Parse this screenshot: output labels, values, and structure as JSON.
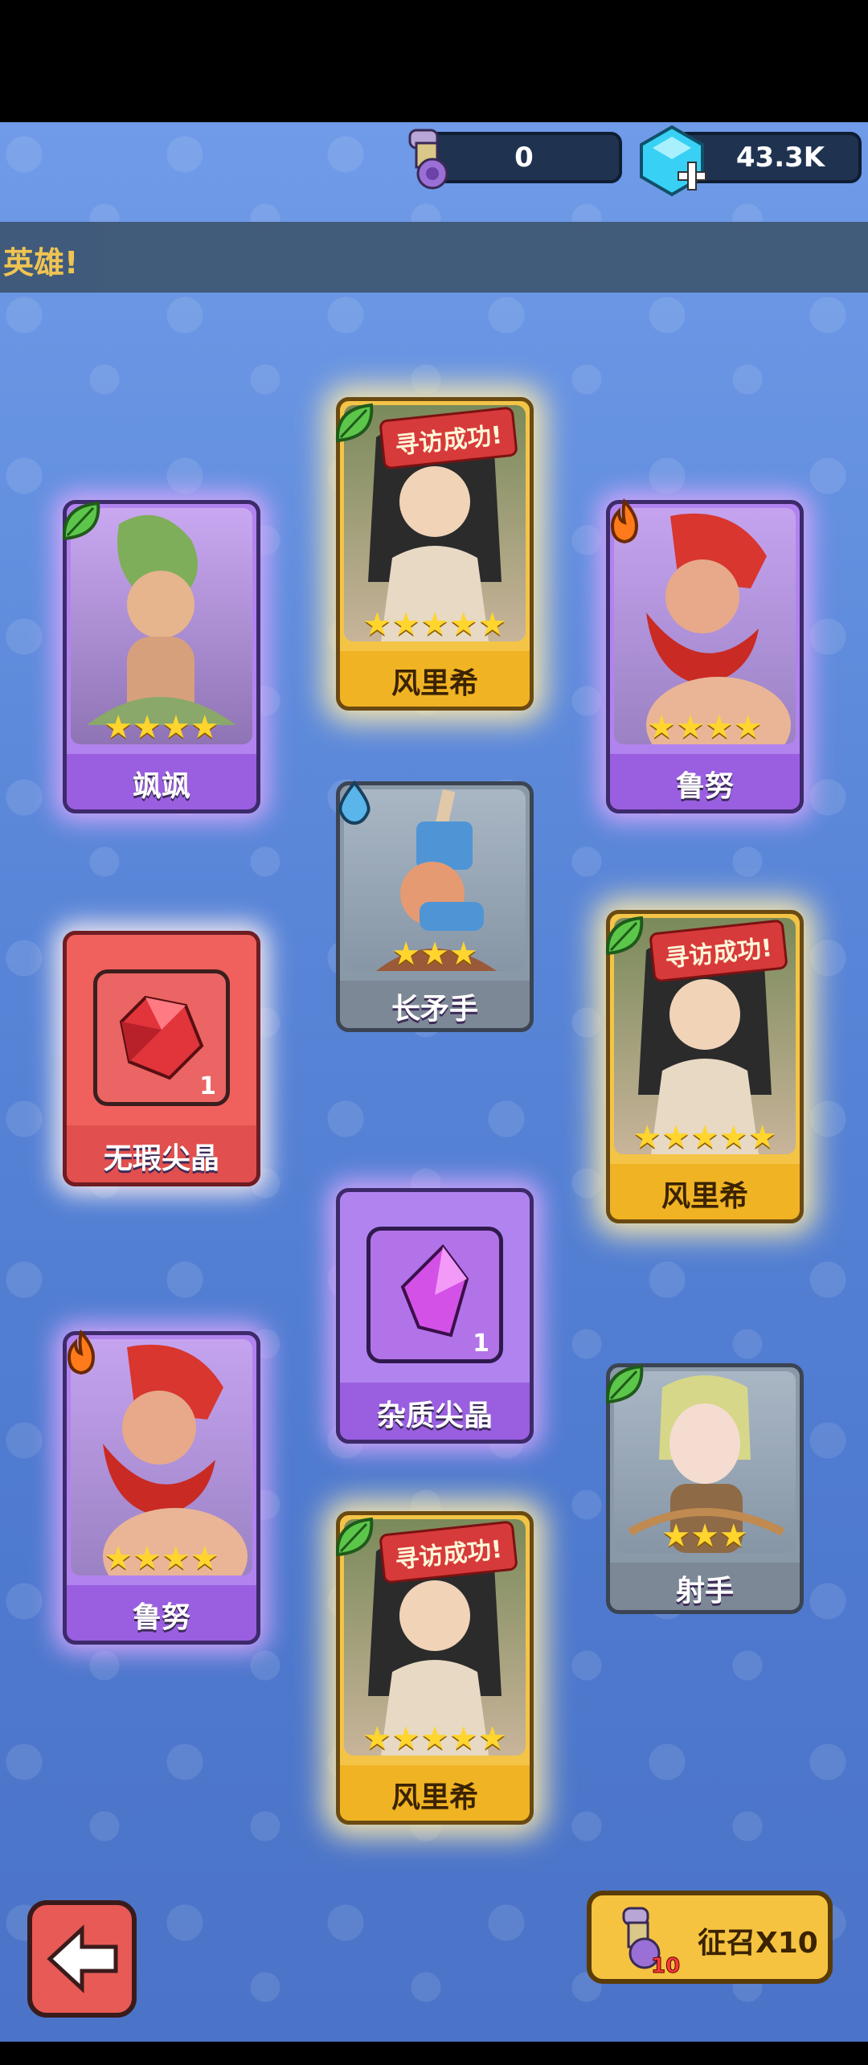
{
  "currency": {
    "scrolls": "0",
    "gems": "43.3K"
  },
  "banner": {
    "text": "英雄!"
  },
  "success_tag": "寻访成功!",
  "cards": [
    {
      "name": "飒飒",
      "stars": 4,
      "rarity": "purple",
      "element": "leaf"
    },
    {
      "name": "风里希",
      "stars": 5,
      "rarity": "gold",
      "element": "leaf",
      "success": true
    },
    {
      "name": "鲁努",
      "stars": 4,
      "rarity": "purple",
      "element": "fire"
    },
    {
      "name": "长矛手",
      "stars": 3,
      "rarity": "gray",
      "element": "water"
    },
    {
      "name": "无瑕尖晶",
      "count": "1",
      "rarity": "red",
      "type": "item"
    },
    {
      "name": "风里希",
      "stars": 5,
      "rarity": "gold",
      "element": "leaf",
      "success": true
    },
    {
      "name": "杂质尖晶",
      "count": "1",
      "rarity": "purple",
      "type": "item"
    },
    {
      "name": "鲁努",
      "stars": 4,
      "rarity": "purple",
      "element": "fire"
    },
    {
      "name": "射手",
      "stars": 3,
      "rarity": "gray",
      "element": "leaf"
    },
    {
      "name": "风里希",
      "stars": 5,
      "rarity": "gold",
      "element": "leaf",
      "success": true
    }
  ],
  "buttons": {
    "summon_label": "征召X10",
    "summon_badge": "10"
  },
  "colors": {
    "background": "#5c88da",
    "gold": "#f4c447",
    "purple": "#b183ef",
    "gray": "#8a99a8",
    "red": "#f0605d"
  },
  "icons": {
    "scroll": "scroll-icon",
    "gem": "gem-plus-icon",
    "back": "back-arrow-icon",
    "leaf": "leaf-element-icon",
    "fire": "fire-element-icon",
    "water": "water-element-icon"
  }
}
